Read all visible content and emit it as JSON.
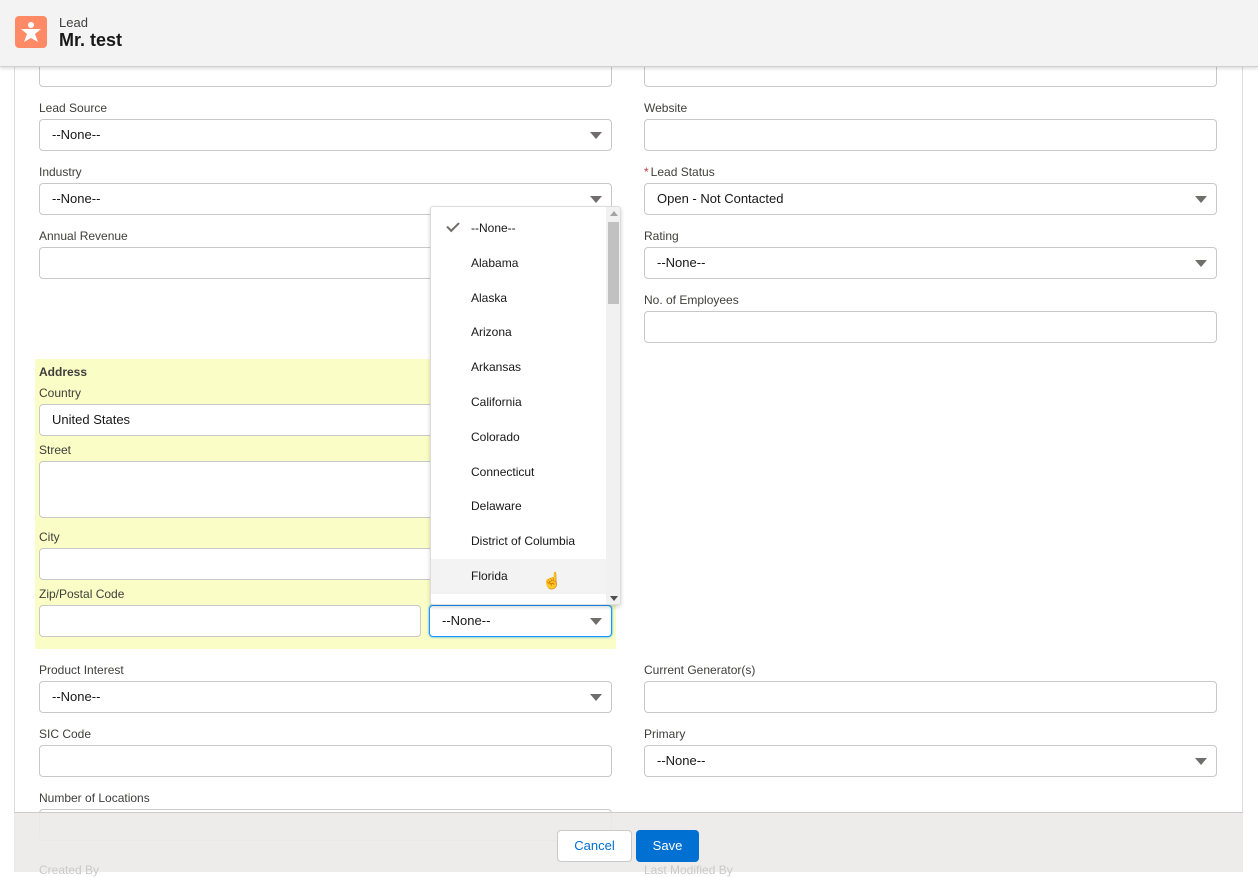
{
  "header": {
    "object_type": "Lead",
    "record_name": "Mr. test",
    "icon": "lead-icon",
    "icon_color": "#ff8a65"
  },
  "left": {
    "lead_source": {
      "label": "Lead Source",
      "value": "--None--"
    },
    "industry": {
      "label": "Industry",
      "value": "--None--"
    },
    "annual_revenue": {
      "label": "Annual Revenue",
      "value": ""
    },
    "address": {
      "title": "Address",
      "country_label": "Country",
      "country_value": "United States",
      "street_label": "Street",
      "city_label": "City",
      "zip_label": "Zip/Postal Code",
      "state_value": "--None--"
    },
    "product_interest": {
      "label": "Product Interest",
      "value": "--None--"
    },
    "sic_code": {
      "label": "SIC Code",
      "value": ""
    },
    "num_locations": {
      "label": "Number of Locations",
      "value": ""
    },
    "created_by": {
      "label": "Created By"
    }
  },
  "right": {
    "website": {
      "label": "Website",
      "value": ""
    },
    "lead_status": {
      "label": "Lead Status",
      "required_mark": "*",
      "value": "Open - Not Contacted"
    },
    "rating": {
      "label": "Rating",
      "value": "--None--"
    },
    "employees": {
      "label": "No. of Employees",
      "value": ""
    },
    "current_generators": {
      "label": "Current Generator(s)",
      "value": ""
    },
    "primary": {
      "label": "Primary",
      "value": "--None--"
    },
    "last_modified_by": {
      "label": "Last Modified By"
    }
  },
  "state_dropdown": {
    "selected": "--None--",
    "hovered": "Florida",
    "options": [
      "--None--",
      "Alabama",
      "Alaska",
      "Arizona",
      "Arkansas",
      "California",
      "Colorado",
      "Connecticut",
      "Delaware",
      "District of Columbia",
      "Florida"
    ]
  },
  "footer": {
    "cancel": "Cancel",
    "save": "Save",
    "save_color": "#0070d2"
  },
  "colors": {
    "address_highlight": "#fafdc5",
    "focus_border": "#1b96ff"
  }
}
